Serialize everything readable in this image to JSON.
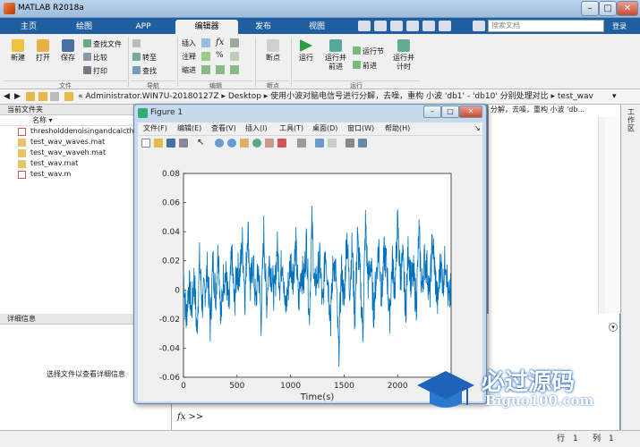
{
  "app": {
    "title": "MATLAB R2018a"
  },
  "tabs": [
    "主页",
    "绘图",
    "APP",
    "编辑器",
    "发布",
    "视图"
  ],
  "search": {
    "placeholder": "搜索文档",
    "login": "登录"
  },
  "ribbon": {
    "new": "新建",
    "open": "打开",
    "save": "保存",
    "find_files": "查找文件",
    "compare": "比较",
    "print": "打印",
    "goto": "转至",
    "find": "查找",
    "insert": "插入",
    "comment": "注释",
    "indent": "缩进",
    "breakpoint": "断点",
    "run": "运行",
    "run_advance_1": "运行并",
    "run_advance_2": "前进",
    "run_section": "运行节",
    "advance": "前进",
    "run_time_1": "运行并",
    "run_time_2": "计时",
    "groups": {
      "file": "文件",
      "nav": "导航",
      "edit": "编辑",
      "bp": "断点",
      "run": "运行"
    }
  },
  "address": {
    "path": "« Administrator.WIN7U-20180127Z ▸ Desktop ▸ 使用小波对脑电信号进行分解，去噪，重构 小波 'db1' - 'db10' 分别处理对比 ▸ test_wav"
  },
  "current_folder": {
    "title": "当前文件夹",
    "column": "名称 ▾",
    "files": [
      {
        "name": "thresholddenoisingandcalcth",
        "type": "m"
      },
      {
        "name": "test_wav_waves.mat",
        "type": "mat"
      },
      {
        "name": "test_wav_waveh.mat",
        "type": "mat"
      },
      {
        "name": "test_wav.mat",
        "type": "mat"
      },
      {
        "name": "test_wav.m",
        "type": "m"
      }
    ]
  },
  "detail": {
    "title": "详细信息",
    "hint": "选择文件以查看详细信息"
  },
  "right_panel": {
    "text": "分解，去噪，重构 小波 'db..."
  },
  "workspace": {
    "label": "工作区"
  },
  "command": {
    "prompt": "fx >>"
  },
  "status": {
    "row_label": "行",
    "row": "1",
    "col_label": "列",
    "col": "1"
  },
  "figure": {
    "title": "Figure 1",
    "menus": [
      "文件(F)",
      "编辑(E)",
      "查看(V)",
      "插入(I)",
      "工具(T)",
      "桌面(D)",
      "窗口(W)",
      "帮助(H)"
    ]
  },
  "watermark": {
    "cn": "必过源码",
    "en": "Biguo100.com"
  },
  "colors": {
    "accent": "#1f5f9f",
    "line": "#0072bd"
  },
  "chart_data": {
    "type": "line",
    "xlabel": "Time(s)",
    "ylabel": "",
    "title": "",
    "xlim": [
      0,
      2500
    ],
    "ylim": [
      -0.06,
      0.08
    ],
    "xticks": [
      0,
      500,
      1000,
      1500,
      2000
    ],
    "yticks": [
      -0.06,
      -0.04,
      -0.02,
      0,
      0.02,
      0.04,
      0.06,
      0.08
    ],
    "series": [
      {
        "x": [
          0,
          25,
          50,
          75,
          100,
          125,
          150,
          175,
          200,
          225,
          250,
          275,
          300,
          325,
          350,
          375,
          400,
          425,
          450,
          475,
          500,
          525,
          550,
          575,
          600,
          625,
          650,
          675,
          700,
          725,
          750,
          775,
          800,
          825,
          850,
          875,
          900,
          925,
          950,
          975,
          1000,
          1025,
          1050,
          1075,
          1100,
          1125,
          1150,
          1175,
          1200,
          1225,
          1250,
          1275,
          1300,
          1325,
          1350,
          1375,
          1400,
          1425,
          1450,
          1475,
          1500,
          1525,
          1550,
          1575,
          1600,
          1625,
          1650,
          1675,
          1700,
          1725,
          1750,
          1775,
          1800,
          1825,
          1850,
          1875,
          1900,
          1925,
          1950,
          1975,
          2000,
          2025,
          2050,
          2075,
          2100,
          2125,
          2150,
          2175,
          2200,
          2225,
          2250,
          2275,
          2300,
          2325,
          2350,
          2375,
          2400,
          2425,
          2450,
          2475,
          2500
        ],
        "y": [
          0.012,
          -0.02,
          0.005,
          -0.015,
          0.01,
          -0.03,
          0.02,
          -0.01,
          0.0,
          0.015,
          -0.025,
          0.02,
          -0.005,
          0.03,
          -0.02,
          0.01,
          0.008,
          -0.015,
          0.025,
          -0.01,
          0.015,
          0.01,
          0.032,
          -0.005,
          0.045,
          0.0,
          0.02,
          -0.01,
          0.015,
          -0.02,
          0.04,
          -0.01,
          0.02,
          0.01,
          -0.005,
          0.03,
          0.005,
          0.025,
          -0.015,
          0.0,
          0.02,
          0.01,
          0.03,
          -0.01,
          0.015,
          0.005,
          0.035,
          -0.02,
          0.045,
          0.0,
          0.01,
          0.02,
          -0.015,
          0.03,
          0.005,
          -0.02,
          0.02,
          0.01,
          -0.045,
          0.015,
          -0.01,
          0.04,
          0.0,
          0.03,
          -0.02,
          0.035,
          0.01,
          -0.03,
          0.045,
          0.005,
          0.02,
          -0.015,
          0.01,
          0.03,
          -0.005,
          0.025,
          0.015,
          -0.02,
          0.02,
          0.0,
          0.045,
          0.01,
          0.02,
          -0.015,
          0.03,
          0.005,
          0.01,
          -0.01,
          0.04,
          0.0,
          0.02,
          0.015,
          -0.005,
          0.035,
          0.01,
          -0.01,
          0.02,
          0.005,
          0.025,
          -0.01,
          0.0
        ]
      }
    ]
  }
}
